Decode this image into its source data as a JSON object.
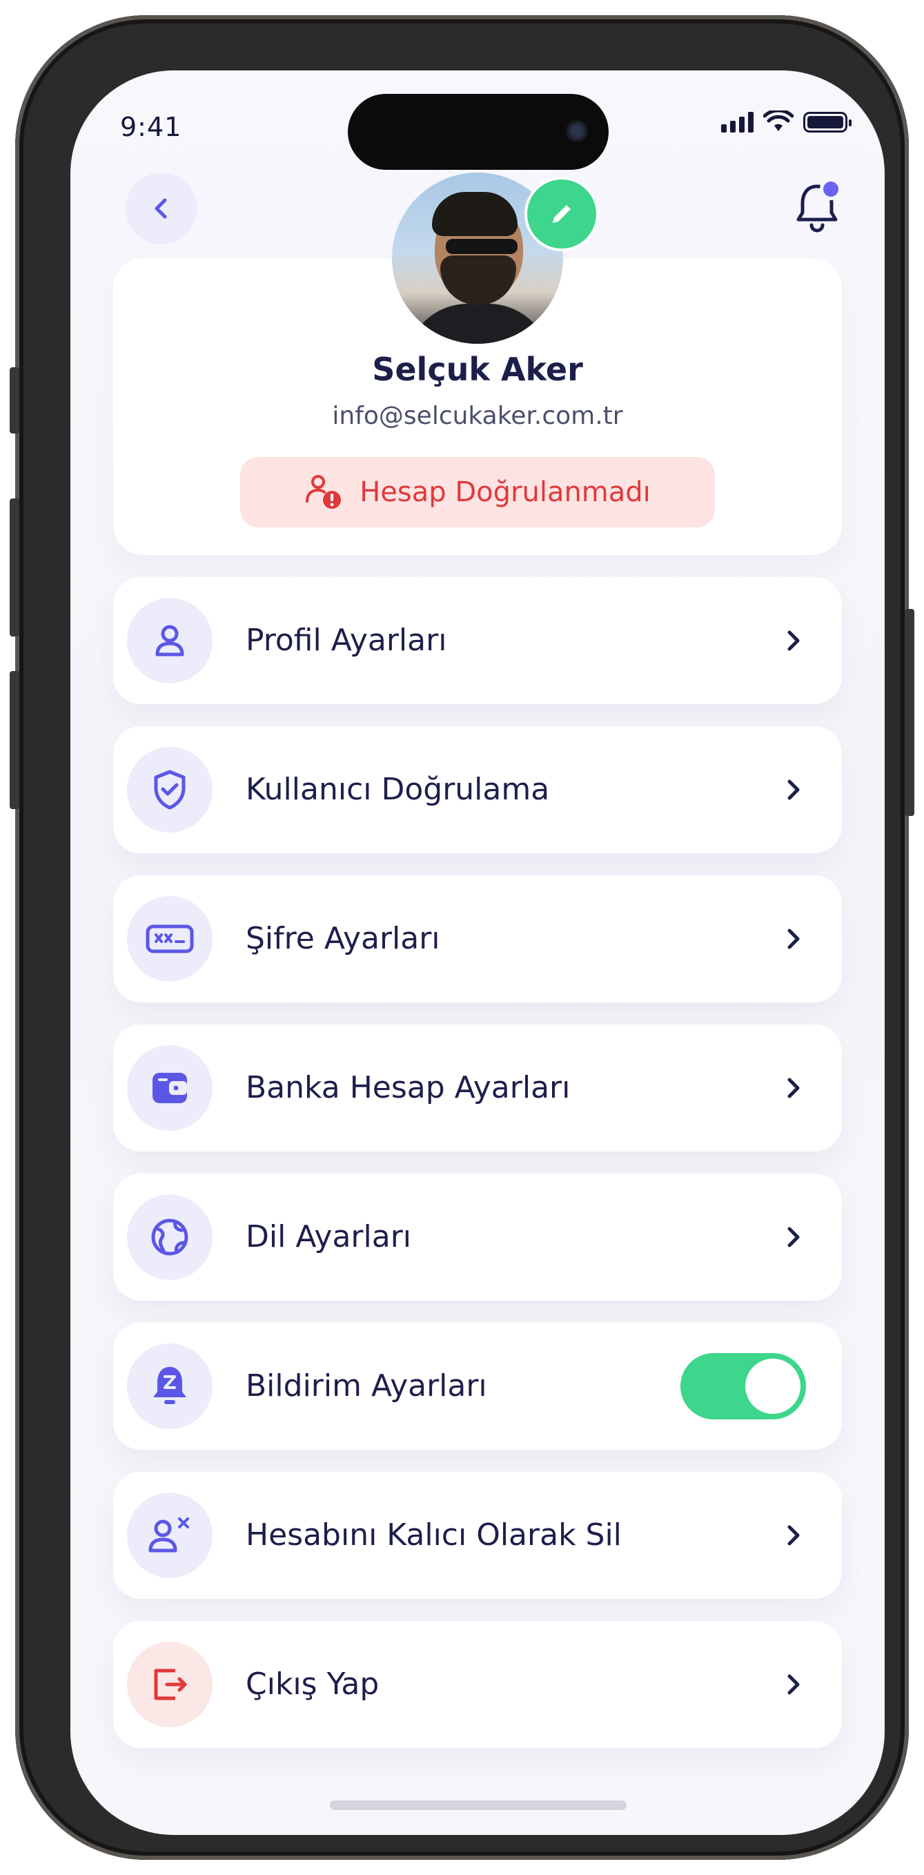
{
  "status_bar": {
    "time": "9:41"
  },
  "profile": {
    "name": "Selçuk Aker",
    "email": "info@selcukaker.com.tr",
    "verification_status": "Hesap Doğrulanmadı"
  },
  "menu": {
    "items": [
      {
        "label": "Profil Ayarları",
        "icon": "user-icon",
        "action": "chevron"
      },
      {
        "label": "Kullanıcı Doğrulama",
        "icon": "shield-check-icon",
        "action": "chevron"
      },
      {
        "label": "Şifre Ayarları",
        "icon": "password-icon",
        "action": "chevron"
      },
      {
        "label": "Banka Hesap Ayarları",
        "icon": "wallet-icon",
        "action": "chevron"
      },
      {
        "label": "Dil Ayarları",
        "icon": "globe-icon",
        "action": "chevron"
      },
      {
        "label": "Bildirim Ayarları",
        "icon": "bell-snooze-icon",
        "action": "toggle",
        "toggle_on": true
      },
      {
        "label": "Hesabını Kalıcı Olarak Sil",
        "icon": "user-remove-icon",
        "action": "chevron"
      },
      {
        "label": "Çıkış Yap",
        "icon": "logout-icon",
        "action": "chevron"
      }
    ]
  },
  "colors": {
    "accent": "#6a63f0",
    "icon_color": "#5b57e6",
    "text_primary": "#1c1f4a",
    "success_green": "#3dd68c",
    "danger_red": "#e0393b",
    "danger_bg": "#fde3e2",
    "icon_bg": "#ececfa"
  }
}
